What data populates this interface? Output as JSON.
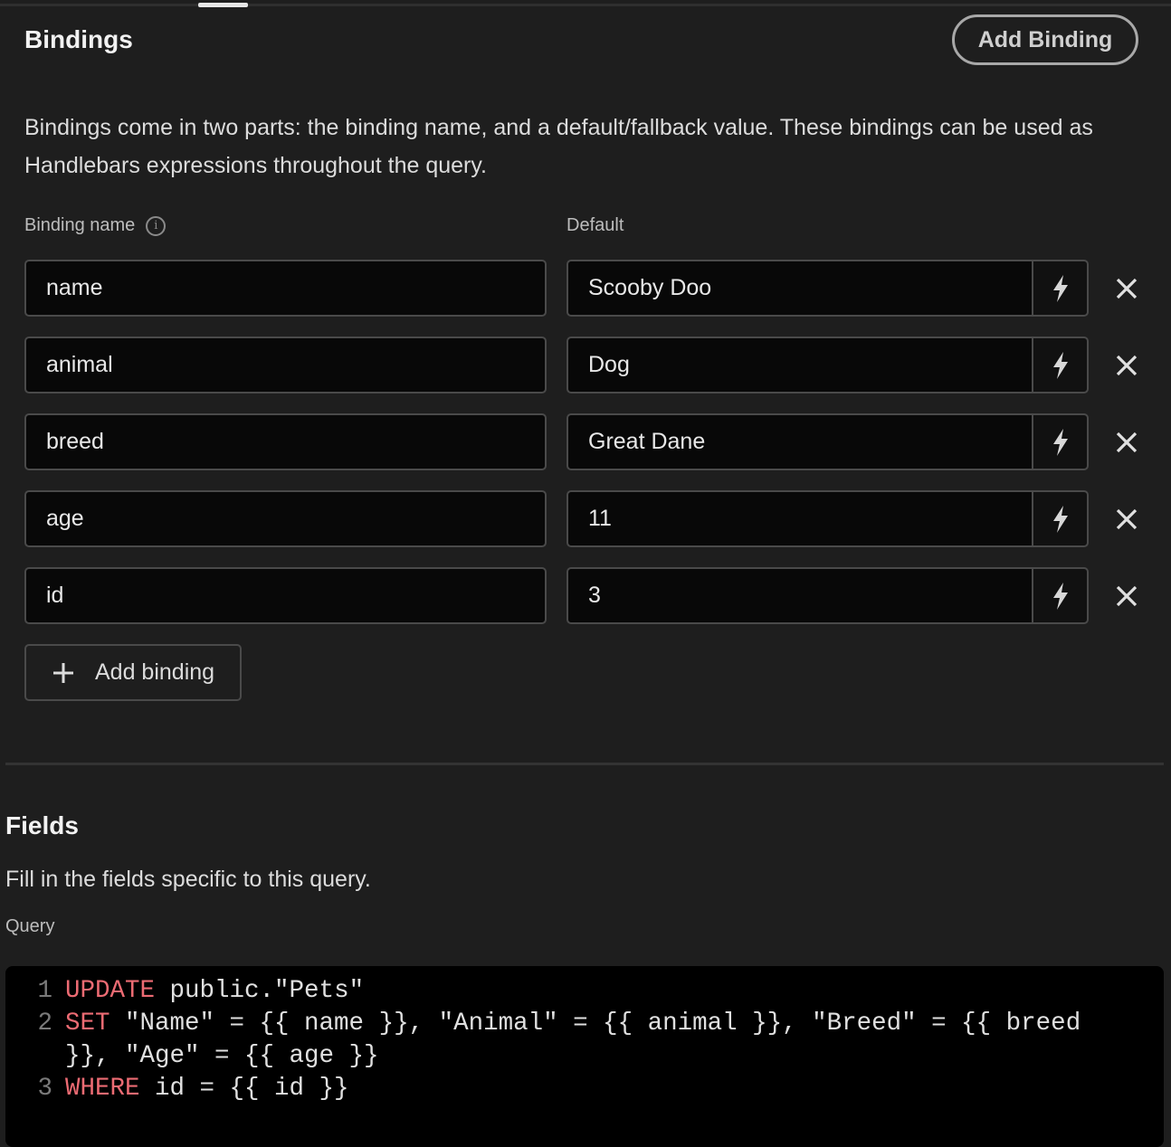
{
  "bindings_section": {
    "title": "Bindings",
    "add_button": "Add Binding",
    "description": "Bindings come in two parts: the binding name, and a default/fallback value. These bindings can be used as Handlebars expressions throughout the query.",
    "name_label": "Binding name",
    "default_label": "Default",
    "rows": [
      {
        "name": "name",
        "default": "Scooby Doo"
      },
      {
        "name": "animal",
        "default": "Dog"
      },
      {
        "name": "breed",
        "default": "Great Dane"
      },
      {
        "name": "age",
        "default": "11"
      },
      {
        "name": "id",
        "default": "3"
      }
    ],
    "add_binding_label": "Add binding"
  },
  "fields_section": {
    "title": "Fields",
    "description": "Fill in the fields specific to this query.",
    "query_label": "Query",
    "code_lines": [
      {
        "num": "1",
        "kw": "UPDATE",
        "rest": " public.\"Pets\""
      },
      {
        "num": "2",
        "kw": "SET",
        "rest": " \"Name\" = {{ name }}, \"Animal\" = {{ animal }}, \"Breed\" = {{ breed }}, \"Age\" = {{ age }}"
      },
      {
        "num": "3",
        "kw": "WHERE",
        "rest": " id = {{ id }}"
      }
    ]
  },
  "colors": {
    "keyword": "#ec6b73",
    "background": "#1e1e1e"
  }
}
